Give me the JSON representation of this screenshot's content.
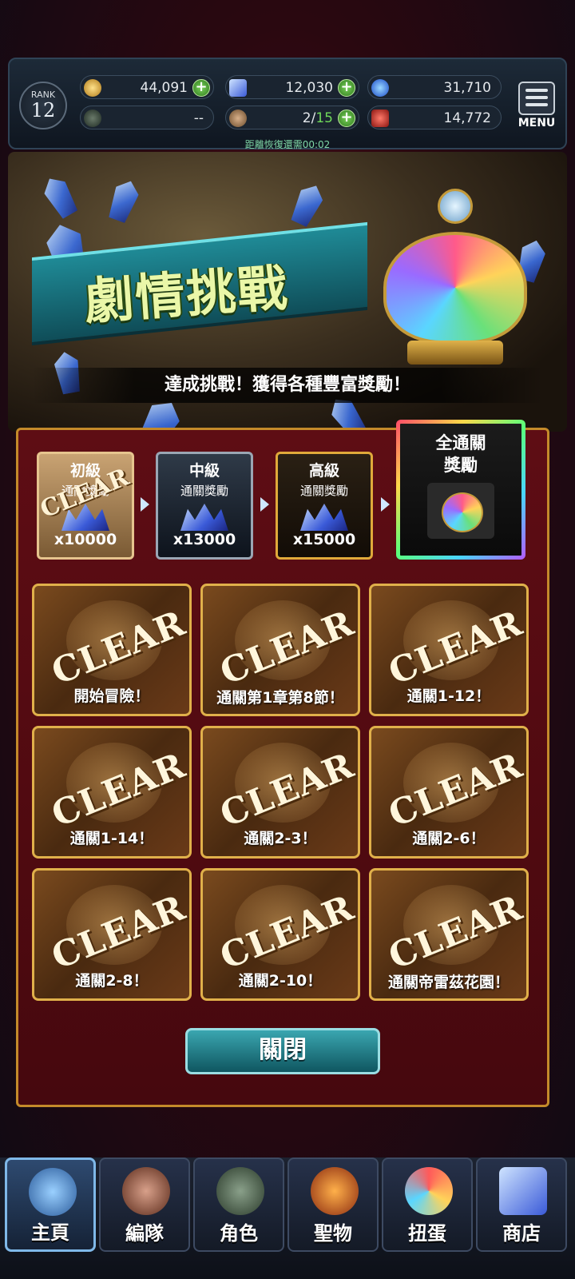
{
  "header": {
    "rank_label": "RANK",
    "rank_value": "12",
    "gil": "44,091",
    "crystals": "12,030",
    "orbs": "31,710",
    "medals": "--",
    "stamina_current": "2",
    "stamina_separator": "/",
    "stamina_max": "15",
    "red_currency": "14,772",
    "menu_label": "MENU",
    "recover_text": "距離恢復還需00:02"
  },
  "banner": {
    "title": "劇情挑戰",
    "subtitle": "達成挑戰！獲得各種豐富獎勵！"
  },
  "tiers": [
    {
      "name": "初級",
      "sub": "通關獎勵",
      "amount": "x10000",
      "stamp": "CLEAR"
    },
    {
      "name": "中級",
      "sub": "通關獎勵",
      "amount": "x13000"
    },
    {
      "name": "高級",
      "sub": "通關獎勵",
      "amount": "x15000"
    },
    {
      "name": "全通關",
      "sub": "獎勵"
    }
  ],
  "challenges": [
    {
      "label": "開始冒險！",
      "stamp": "CLEAR"
    },
    {
      "label": "通關第1章第8節！",
      "stamp": "CLEAR"
    },
    {
      "label": "通關1-12！",
      "stamp": "CLEAR"
    },
    {
      "label": "通關1-14！",
      "stamp": "CLEAR"
    },
    {
      "label": "通關2-3！",
      "stamp": "CLEAR"
    },
    {
      "label": "通關2-6！",
      "stamp": "CLEAR"
    },
    {
      "label": "通關2-8！",
      "stamp": "CLEAR"
    },
    {
      "label": "通關2-10！",
      "stamp": "CLEAR"
    },
    {
      "label": "通關帝雷茲花園！",
      "stamp": "CLEAR"
    }
  ],
  "close_label": "關閉",
  "nav": [
    {
      "label": "主頁",
      "icon": "home-crest-icon",
      "active": true
    },
    {
      "label": "編隊",
      "icon": "party-icon"
    },
    {
      "label": "角色",
      "icon": "character-icon"
    },
    {
      "label": "聖物",
      "icon": "relic-icon"
    },
    {
      "label": "扭蛋",
      "icon": "gacha-icon"
    },
    {
      "label": "商店",
      "icon": "shop-crystal-icon"
    }
  ],
  "colors": {
    "accent_gold": "#e0b04a",
    "panel_red": "#5e0d14",
    "close_teal": "#3aa6b0"
  }
}
